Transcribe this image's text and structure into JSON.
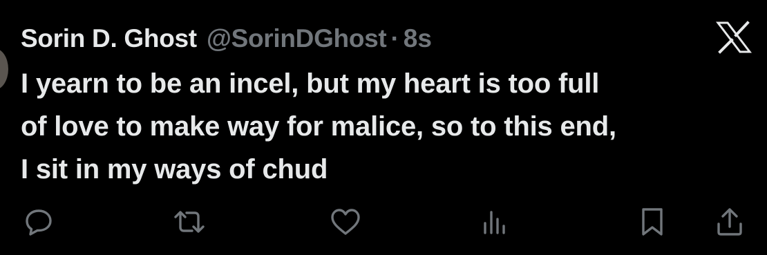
{
  "tweet": {
    "display_name": "Sorin D. Ghost",
    "handle": "@SorinDGhost",
    "separator": "·",
    "timestamp": "8s",
    "text_lines": [
      "I yearn to be an incel, but my heart is too full",
      "of love to make way for malice, so to this end,",
      "I sit in my ways of chud"
    ]
  },
  "icons": {
    "brand": "x-logo-icon",
    "reply": "reply-icon",
    "retweet": "retweet-icon",
    "like": "heart-icon",
    "views": "views-chart-icon",
    "bookmark": "bookmark-icon",
    "share": "share-icon"
  },
  "colors": {
    "background": "#000000",
    "primary_text": "#e7e9ea",
    "secondary_text": "#71767b",
    "icon": "#71767b"
  }
}
